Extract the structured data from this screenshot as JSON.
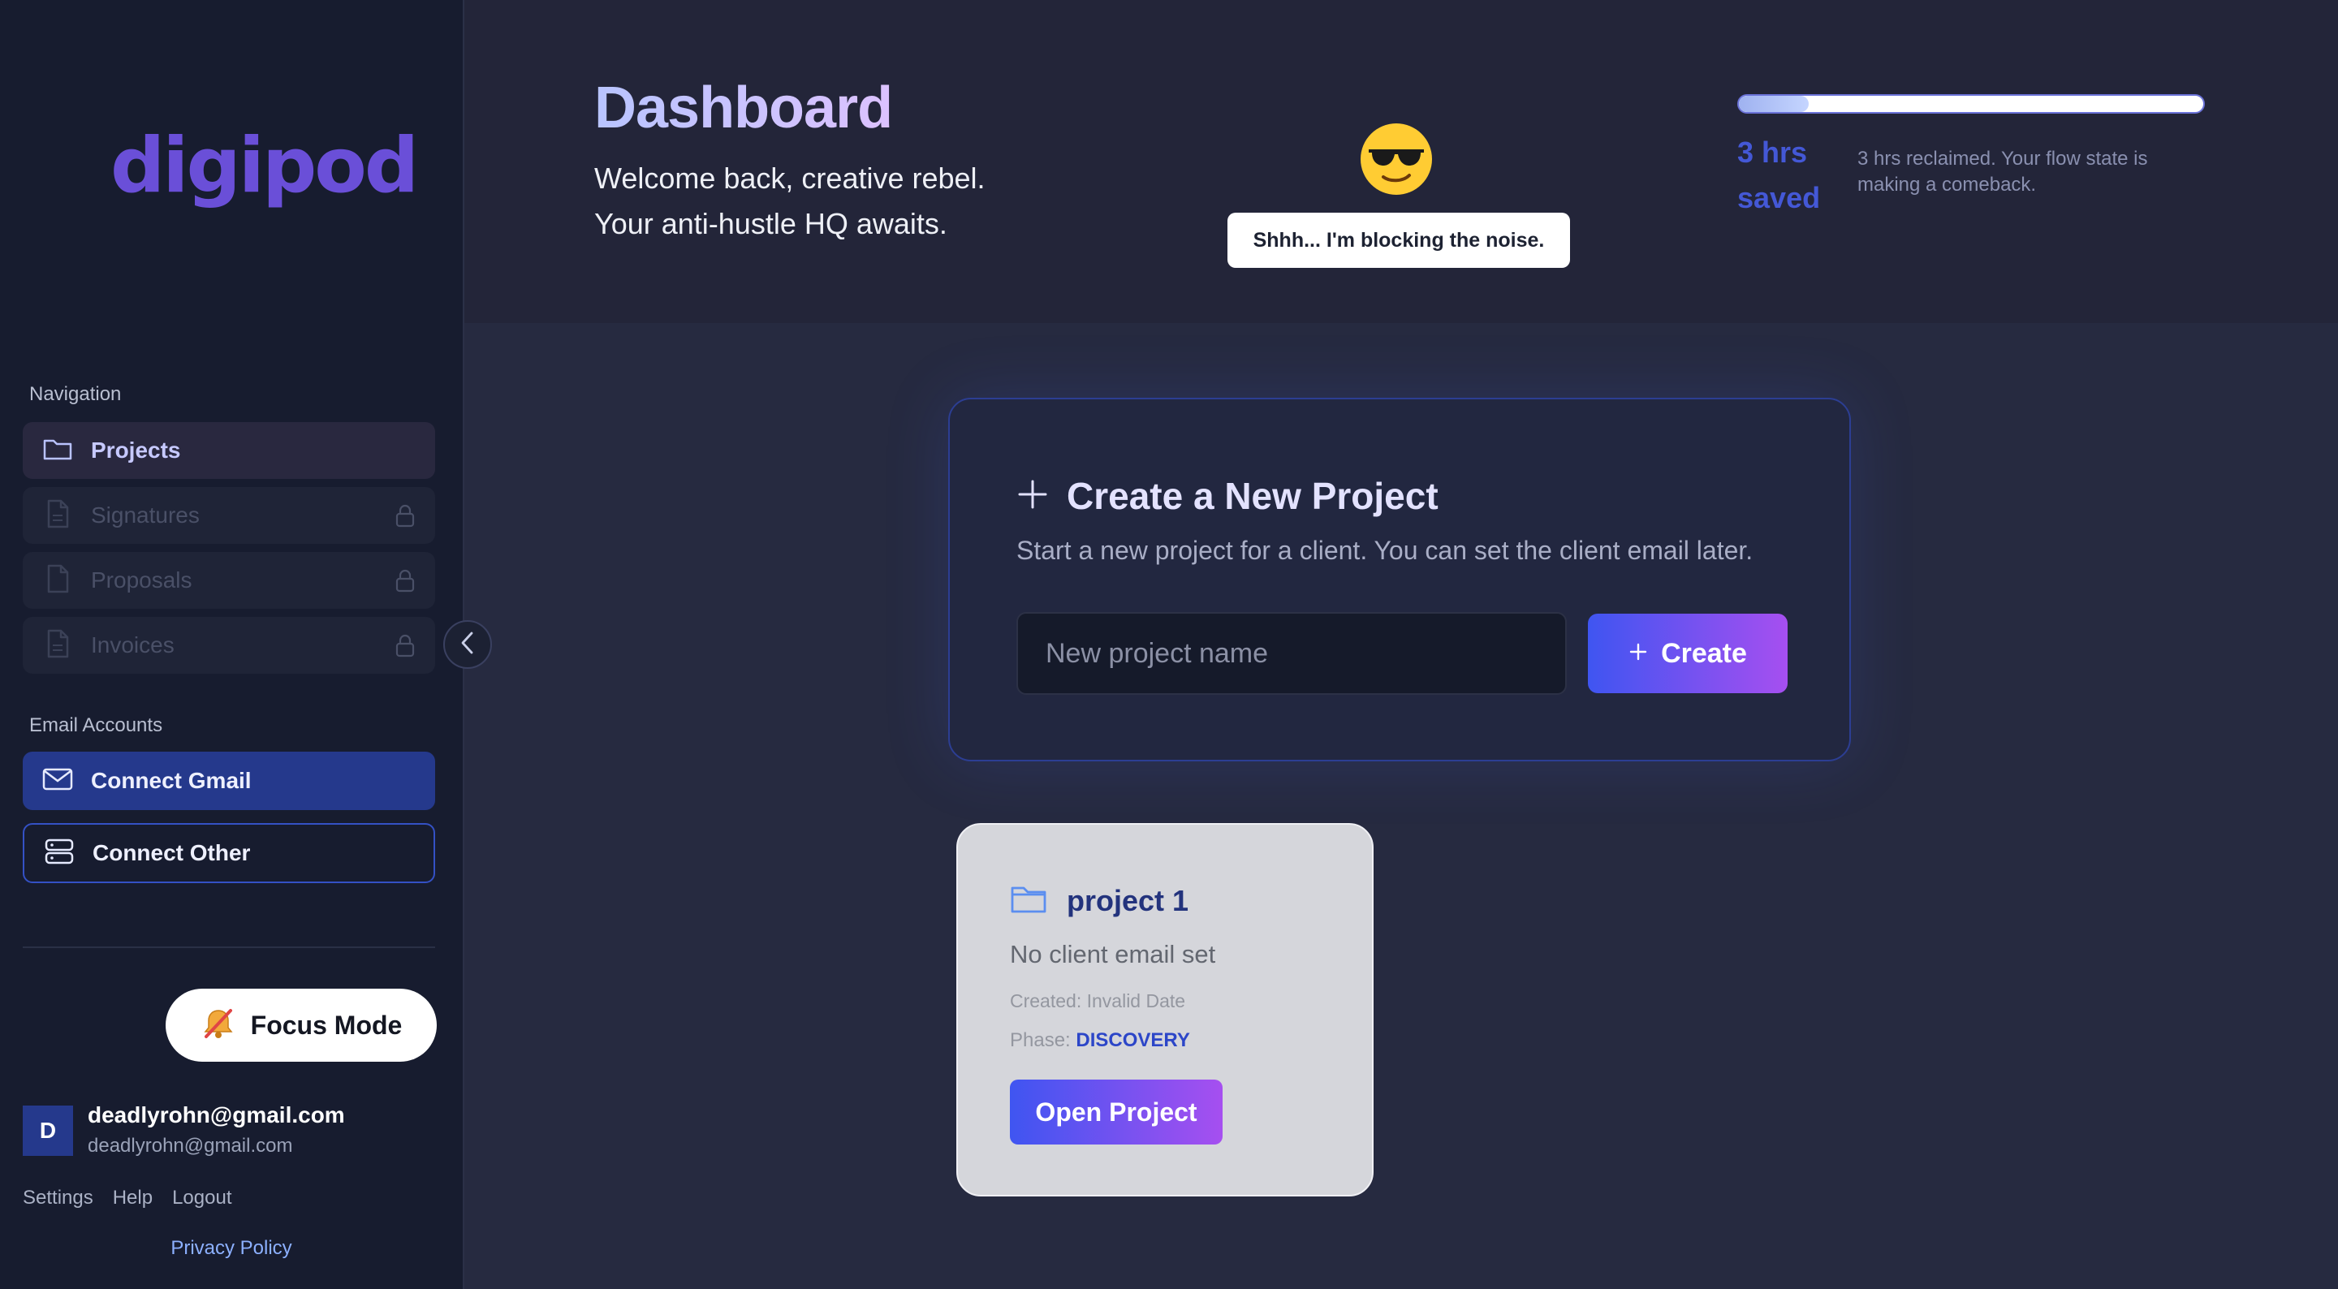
{
  "app": {
    "logo": "digipod"
  },
  "sidebar": {
    "nav_label": "Navigation",
    "nav_items": [
      {
        "label": "Projects",
        "icon": "folder-icon",
        "locked": false
      },
      {
        "label": "Signatures",
        "icon": "file-icon",
        "locked": true
      },
      {
        "label": "Proposals",
        "icon": "file-icon",
        "locked": true
      },
      {
        "label": "Invoices",
        "icon": "file-icon",
        "locked": true
      }
    ],
    "email_label": "Email Accounts",
    "connect_gmail": "Connect Gmail",
    "connect_other": "Connect Other",
    "focus_mode": "Focus Mode",
    "user": {
      "initial": "D",
      "name": "deadlyrohn@gmail.com",
      "email": "deadlyrohn@gmail.com"
    },
    "footer_links": [
      "Settings",
      "Help",
      "Logout"
    ],
    "privacy": "Privacy Policy"
  },
  "header": {
    "title": "Dashboard",
    "welcome_line1": "Welcome back, creative rebel.",
    "welcome_line2": "Your anti-hustle HQ awaits.",
    "tooltip": "Shhh... I'm blocking the noise.",
    "progress_fraction": 0.15,
    "hrs_saved_line1": "3 hrs",
    "hrs_saved_line2": "saved",
    "hrs_note": "3 hrs reclaimed. Your flow state is making a comeback."
  },
  "create": {
    "title": "Create a New Project",
    "description": "Start a new project for a client. You can set the client email later.",
    "placeholder": "New project name",
    "button": "Create"
  },
  "project": {
    "name": "project 1",
    "email": "No client email set",
    "created": "Created: Invalid Date",
    "phase_label": "Phase:",
    "phase": "DISCOVERY",
    "button": "Open Project"
  },
  "colors": {
    "accent": "#3f55f1",
    "accent_end": "#a64ff0",
    "sidebar_bg": "#171c2f",
    "main_bg": "#262a40",
    "logo": "#6a4fd8"
  }
}
